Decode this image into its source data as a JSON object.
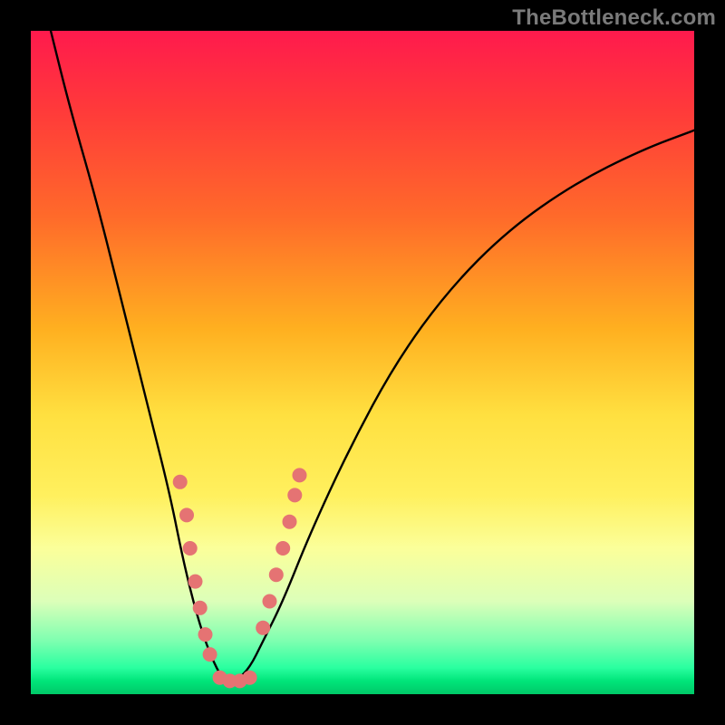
{
  "watermark": "TheBottleneck.com",
  "chart_data": {
    "type": "line",
    "title": "",
    "xlabel": "",
    "ylabel": "",
    "xlim": [
      0,
      100
    ],
    "ylim": [
      0,
      100
    ],
    "grid": false,
    "legend": false,
    "series": [
      {
        "name": "bottleneck-curve",
        "color": "#000000",
        "x": [
          3,
          6,
          10,
          14,
          18,
          21,
          23,
          25,
          27,
          29,
          31,
          33,
          35,
          38,
          42,
          48,
          55,
          63,
          72,
          82,
          92,
          100
        ],
        "y": [
          100,
          88,
          74,
          58,
          42,
          30,
          20,
          12,
          6,
          2,
          2,
          4,
          8,
          14,
          24,
          37,
          50,
          61,
          70,
          77,
          82,
          85
        ]
      }
    ],
    "annotations": {
      "scatter_points_left_branch": [
        {
          "x": 22.5,
          "y": 32
        },
        {
          "x": 23.5,
          "y": 27
        },
        {
          "x": 24.0,
          "y": 22
        },
        {
          "x": 24.8,
          "y": 17
        },
        {
          "x": 25.5,
          "y": 13
        },
        {
          "x": 26.3,
          "y": 9
        },
        {
          "x": 27.0,
          "y": 6
        }
      ],
      "scatter_points_right_branch": [
        {
          "x": 35.0,
          "y": 10
        },
        {
          "x": 36.0,
          "y": 14
        },
        {
          "x": 37.0,
          "y": 18
        },
        {
          "x": 38.0,
          "y": 22
        },
        {
          "x": 39.0,
          "y": 26
        },
        {
          "x": 39.8,
          "y": 30
        },
        {
          "x": 40.5,
          "y": 33
        }
      ],
      "scatter_points_bottom_cluster": [
        {
          "x": 28.5,
          "y": 2.5
        },
        {
          "x": 30.0,
          "y": 2.0
        },
        {
          "x": 31.5,
          "y": 2.0
        },
        {
          "x": 33.0,
          "y": 2.5
        }
      ],
      "scatter_color": "#e57373",
      "scatter_radius_px": 8
    },
    "background_gradient": {
      "orientation": "vertical",
      "stops": [
        {
          "pos": 0.0,
          "color": "#ff1a4d"
        },
        {
          "pos": 0.28,
          "color": "#ff6a2a"
        },
        {
          "pos": 0.58,
          "color": "#ffe040"
        },
        {
          "pos": 0.78,
          "color": "#fbff9a"
        },
        {
          "pos": 0.92,
          "color": "#7dffb0"
        },
        {
          "pos": 1.0,
          "color": "#00c868"
        }
      ]
    }
  }
}
